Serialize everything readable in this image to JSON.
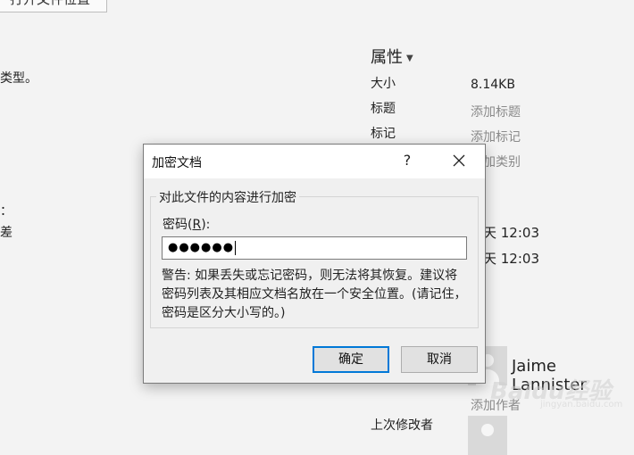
{
  "background": {
    "top_button_text": "打开文件位置",
    "left_fragments": [
      "类型。",
      "：",
      "差"
    ]
  },
  "properties": {
    "title": "属性",
    "rows": [
      {
        "label": "大小",
        "value": "8.14KB"
      },
      {
        "label": "标题",
        "placeholder": "添加标题"
      },
      {
        "label": "标记",
        "placeholder": "添加标记"
      },
      {
        "placeholder": "加类别"
      }
    ],
    "date_fragments": [
      "天 12:03",
      "天 12:03"
    ],
    "author_name": "Jaime Lannister",
    "add_author": "添加作者",
    "last_modified_label": "上次修改者"
  },
  "watermark": {
    "text": "Baidu经验",
    "sub": "jingyan.baidu.com"
  },
  "dialog": {
    "title": "加密文档",
    "help_label": "?",
    "group_title": "对此文件的内容进行加密",
    "password_label_prefix": "密码(",
    "password_label_key": "R",
    "password_label_suffix": "):",
    "password_value": "●●●●●●",
    "warning": "警告: 如果丢失或忘记密码，则无法将其恢复。建议将密码列表及其相应文档名放在一个安全位置。(请记住，密码是区分大小写的。)",
    "ok_label": "确定",
    "cancel_label": "取消"
  },
  "colors": {
    "accent": "#0078d7",
    "dialog_bg": "#f0f0f0",
    "placeholder": "#8a8a8a"
  },
  "icons": [
    "close-icon",
    "caret-down-icon",
    "avatar-icon"
  ]
}
